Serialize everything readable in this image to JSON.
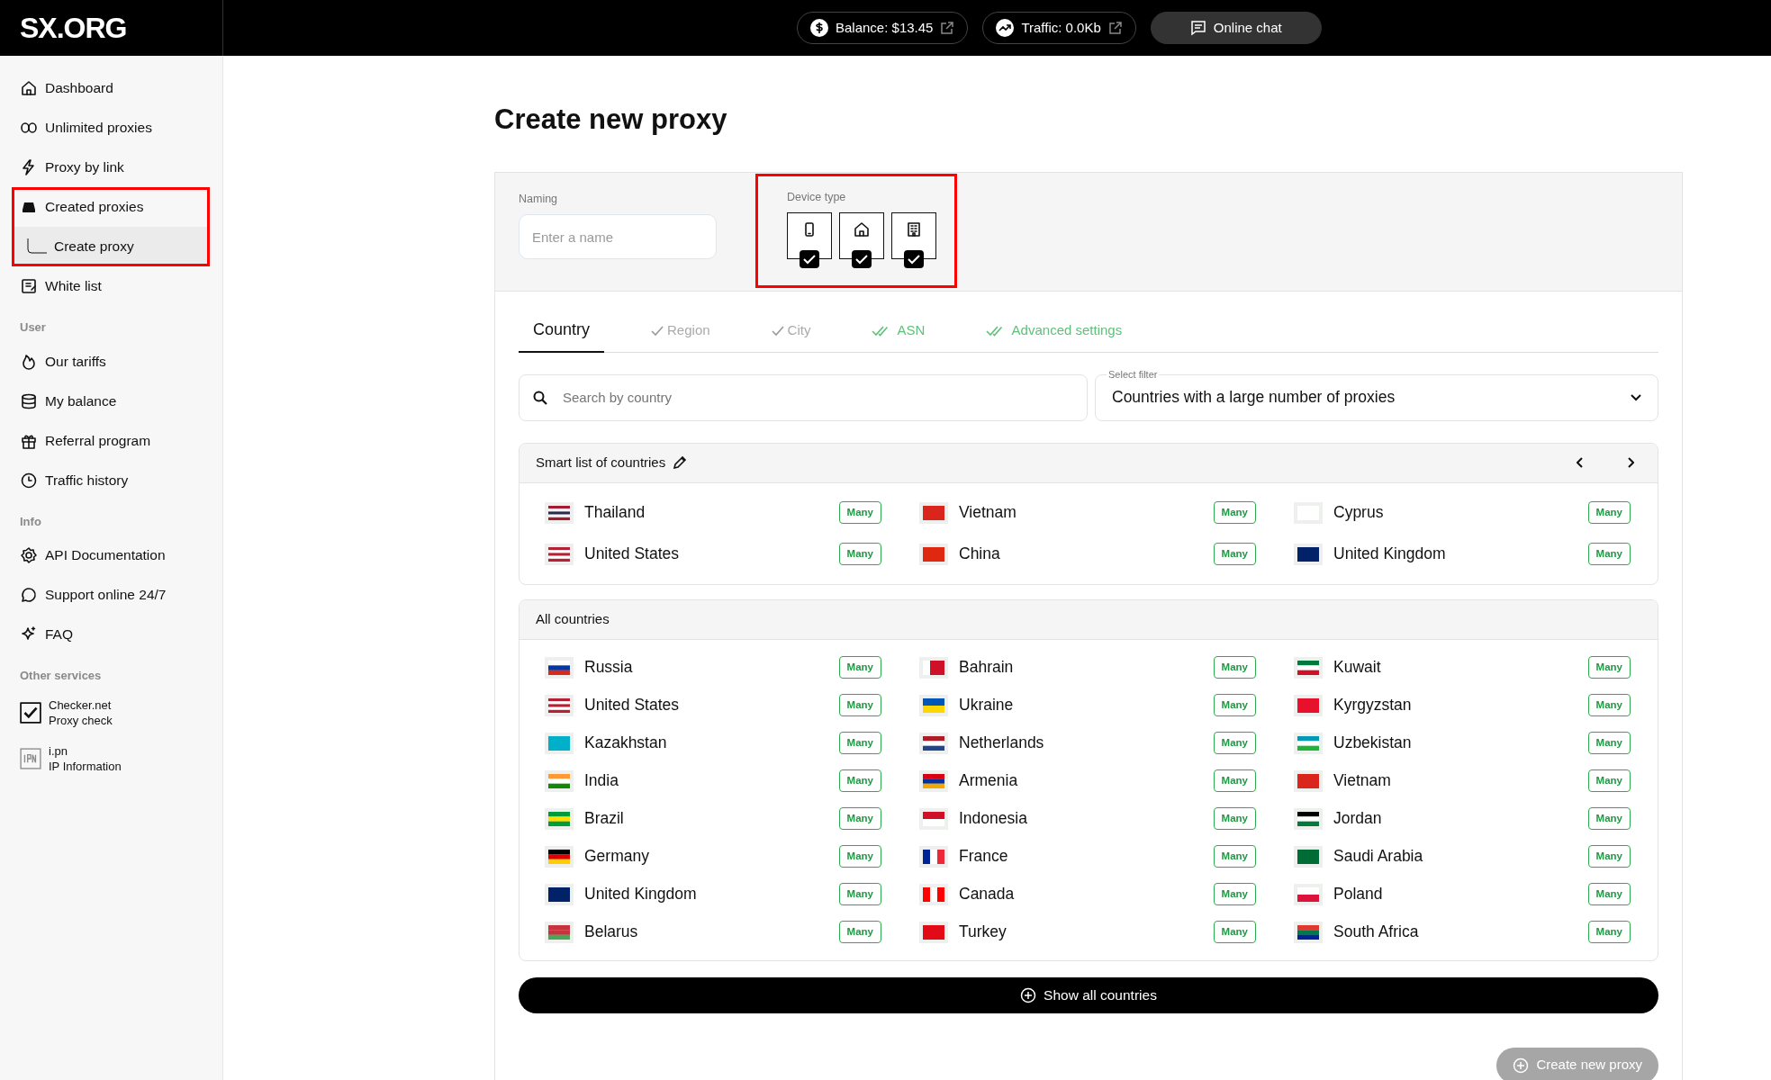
{
  "header": {
    "logo": "SX.ORG",
    "balance": "Balance: $13.45",
    "traffic": "Traffic: 0.0Kb",
    "chat": "Online chat"
  },
  "sidebar": {
    "sections": [
      {
        "items": [
          {
            "label": "Dashboard",
            "selected": false,
            "highlighted": false
          },
          {
            "label": "Unlimited proxies",
            "selected": false,
            "highlighted": false
          },
          {
            "label": "Proxy by link",
            "selected": false,
            "highlighted": false
          },
          {
            "label": "Created proxies",
            "selected": false,
            "highlighted": true,
            "children": [
              {
                "label": "Create proxy",
                "selected": true
              }
            ]
          },
          {
            "label": "White list",
            "selected": false,
            "highlighted": false
          }
        ]
      },
      {
        "title": "User",
        "items": [
          {
            "label": "Our tariffs",
            "selected": false,
            "highlighted": false
          },
          {
            "label": "My balance",
            "selected": false,
            "highlighted": false
          },
          {
            "label": "Referral program",
            "selected": false,
            "highlighted": false
          },
          {
            "label": "Traffic history",
            "selected": false,
            "highlighted": false
          }
        ]
      },
      {
        "title": "Info",
        "items": [
          {
            "label": "API Documentation",
            "selected": false,
            "highlighted": false
          },
          {
            "label": "Support online 24/7",
            "selected": false,
            "highlighted": false
          },
          {
            "label": "FAQ",
            "selected": false,
            "highlighted": false
          }
        ]
      },
      {
        "title": "Other services",
        "services": [
          {
            "name": "Checker.net",
            "desc": "Proxy check"
          },
          {
            "name": "i.pn",
            "desc": "IP Information"
          }
        ]
      }
    ]
  },
  "page_title": "Create new proxy",
  "naming": {
    "label": "Naming",
    "placeholder": "Enter a name"
  },
  "device_type": {
    "label": "Device type",
    "highlighted": true,
    "devices": [
      {
        "checked": true
      },
      {
        "checked": true
      },
      {
        "checked": true
      }
    ]
  },
  "tabs": [
    {
      "label": "Country",
      "kind": "plain",
      "selected": true
    },
    {
      "label": "Region",
      "kind": "check",
      "selected": false
    },
    {
      "label": "City",
      "kind": "check",
      "selected": false
    },
    {
      "label": "ASN",
      "kind": "double-check",
      "selected": false
    },
    {
      "label": "Advanced settings",
      "kind": "double-check",
      "selected": false
    }
  ],
  "search": {
    "placeholder": "Search by country"
  },
  "filter": {
    "label": "Select filter",
    "value": "Countries with a large number of proxies"
  },
  "smart_list": {
    "title": "Smart list of countries",
    "countries": [
      {
        "name": "Thailand",
        "badge": "Many"
      },
      {
        "name": "Vietnam",
        "badge": "Many"
      },
      {
        "name": "Cyprus",
        "badge": "Many"
      },
      {
        "name": "United States",
        "badge": "Many"
      },
      {
        "name": "China",
        "badge": "Many"
      },
      {
        "name": "United Kingdom",
        "badge": "Many"
      }
    ]
  },
  "all_countries": {
    "title": "All countries",
    "countries": [
      {
        "name": "Russia",
        "badge": "Many"
      },
      {
        "name": "Bahrain",
        "badge": "Many"
      },
      {
        "name": "Kuwait",
        "badge": "Many"
      },
      {
        "name": "United States",
        "badge": "Many"
      },
      {
        "name": "Ukraine",
        "badge": "Many"
      },
      {
        "name": "Kyrgyzstan",
        "badge": "Many"
      },
      {
        "name": "Kazakhstan",
        "badge": "Many"
      },
      {
        "name": "Netherlands",
        "badge": "Many"
      },
      {
        "name": "Uzbekistan",
        "badge": "Many"
      },
      {
        "name": "India",
        "badge": "Many"
      },
      {
        "name": "Armenia",
        "badge": "Many"
      },
      {
        "name": "Vietnam",
        "badge": "Many"
      },
      {
        "name": "Brazil",
        "badge": "Many"
      },
      {
        "name": "Indonesia",
        "badge": "Many"
      },
      {
        "name": "Jordan",
        "badge": "Many"
      },
      {
        "name": "Germany",
        "badge": "Many"
      },
      {
        "name": "France",
        "badge": "Many"
      },
      {
        "name": "Saudi Arabia",
        "badge": "Many"
      },
      {
        "name": "United Kingdom",
        "badge": "Many"
      },
      {
        "name": "Canada",
        "badge": "Many"
      },
      {
        "name": "Poland",
        "badge": "Many"
      },
      {
        "name": "Belarus",
        "badge": "Many"
      },
      {
        "name": "Turkey",
        "badge": "Many"
      },
      {
        "name": "South Africa",
        "badge": "Many"
      }
    ]
  },
  "show_all": "Show all countries",
  "create_button": {
    "label": "Create new proxy",
    "disabled": true
  }
}
